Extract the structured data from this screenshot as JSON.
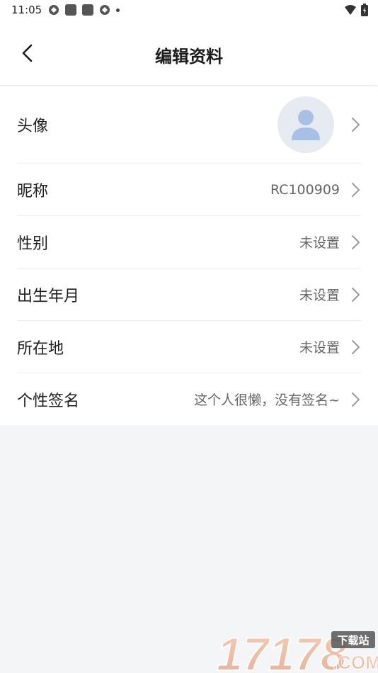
{
  "status_bar": {
    "time": "11:05",
    "left_icons": [
      "sync-icon",
      "app-icon",
      "app-icon",
      "sync-icon",
      "dot-icon"
    ],
    "right_icons": [
      "wifi-icon",
      "battery-icon"
    ]
  },
  "header": {
    "title": "编辑资料",
    "back_icon": "chevron-left-icon"
  },
  "profile": {
    "avatar": {
      "label": "头像",
      "icon": "default-avatar-icon"
    },
    "rows": [
      {
        "label": "昵称",
        "value": "RC100909"
      },
      {
        "label": "性别",
        "value": "未设置"
      },
      {
        "label": "出生年月",
        "value": "未设置"
      },
      {
        "label": "所在地",
        "value": "未设置"
      },
      {
        "label": "个性签名",
        "value": "这个人很懒，没有签名~"
      }
    ]
  },
  "watermark": {
    "text": "17178",
    "badge": "下载站",
    "suffix": ".COM"
  },
  "colors": {
    "background": "#f4f5f7",
    "card": "#ffffff",
    "avatar_bg": "#e6ebf2",
    "avatar_fg": "#a9c0e6",
    "chevron": "#9a9a9a"
  }
}
